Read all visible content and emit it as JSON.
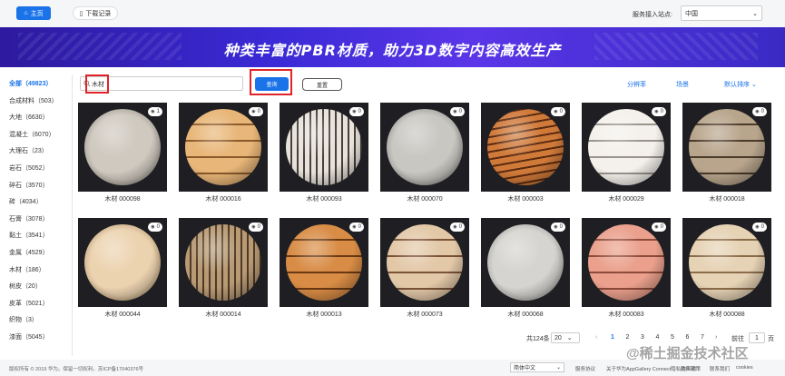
{
  "topbar": {
    "home_label": "主页",
    "downloads_label": "下载记录",
    "site_label": "服务接入站点:",
    "site_value": "中国"
  },
  "banner": {
    "text": "种类丰富的PBR材质，助力3D数字内容高效生产"
  },
  "sidebar": {
    "categories": [
      {
        "label": "全部（49823）"
      },
      {
        "label": "合成材料（503）"
      },
      {
        "label": "大地（6630）"
      },
      {
        "label": "混凝土（6070）"
      },
      {
        "label": "大理石（23）"
      },
      {
        "label": "岩石（5052）"
      },
      {
        "label": "碎石（3570）"
      },
      {
        "label": "砖（4034）"
      },
      {
        "label": "石膏（3078）"
      },
      {
        "label": "黏土（3541）"
      },
      {
        "label": "金属（4529）"
      },
      {
        "label": "木材（186）"
      },
      {
        "label": "树皮（20）"
      },
      {
        "label": "皮革（5021）"
      },
      {
        "label": "织物（3）"
      },
      {
        "label": "漆面（5045）"
      }
    ]
  },
  "search": {
    "value": "木材",
    "query_label": "查询",
    "reset_label": "重置"
  },
  "toplinks": {
    "category": "分辨率",
    "scene": "场景",
    "sort": "默认排序"
  },
  "materials": [
    {
      "name": "木材 000098",
      "views": "1",
      "color1": "#cfc9bf",
      "color2": "#6e6962",
      "type": "plain"
    },
    {
      "name": "木材 000016",
      "views": "0",
      "color1": "#e8b678",
      "color2": "#8a5a2b",
      "type": "planks"
    },
    {
      "name": "木材 000093",
      "views": "0",
      "color1": "#e6e2dc",
      "color2": "#4a3e36",
      "type": "stripes"
    },
    {
      "name": "木材 000070",
      "views": "0",
      "color1": "#c9c7c2",
      "color2": "#6a6864",
      "type": "plain"
    },
    {
      "name": "木材 000003",
      "views": "0",
      "color1": "#d07a3a",
      "color2": "#5a2a10",
      "type": "grain"
    },
    {
      "name": "木材 000029",
      "views": "0",
      "color1": "#f4f1ec",
      "color2": "#9a958c",
      "type": "planks"
    },
    {
      "name": "木材 000018",
      "views": "0",
      "color1": "#b8a58c",
      "color2": "#4a3a2a",
      "type": "planks"
    },
    {
      "name": "木材 000044",
      "views": "0",
      "color1": "#ecd3b0",
      "color2": "#8e6e48",
      "type": "plain"
    },
    {
      "name": "木材 000014",
      "views": "0",
      "color1": "#b89a74",
      "color2": "#4e3a26",
      "type": "stripes"
    },
    {
      "name": "木材 000013",
      "views": "0",
      "color1": "#d88c45",
      "color2": "#6a3812",
      "type": "planks"
    },
    {
      "name": "木材 000073",
      "views": "0",
      "color1": "#e3c8a8",
      "color2": "#7a5236",
      "type": "planks"
    },
    {
      "name": "木材 000068",
      "views": "0",
      "color1": "#d6d4d0",
      "color2": "#7e7c78",
      "type": "plain"
    },
    {
      "name": "木材 000083",
      "views": "0",
      "color1": "#eaa08c",
      "color2": "#8e4a3a",
      "type": "planks"
    },
    {
      "name": "木材 000088",
      "views": "0",
      "color1": "#e6d2b4",
      "color2": "#8a6c48",
      "type": "planks"
    }
  ],
  "pagination": {
    "total": "共124条",
    "page_size": "20",
    "pages": [
      "1",
      "2",
      "3",
      "4",
      "5",
      "6",
      "7"
    ],
    "current": "1",
    "goto_label": "前往",
    "goto_value": "1",
    "goto_suffix": "页"
  },
  "footer": {
    "copyright": "版权所有 © 2019 华为。保留一切权利。苏ICP备17040376号",
    "language": "简体中文",
    "links": [
      "服务协议",
      "关于华为AppGallery Connect隐私的声明",
      "隐私政策",
      "联系我们",
      "cookies"
    ]
  },
  "watermark": "@稀土掘金技术社区"
}
